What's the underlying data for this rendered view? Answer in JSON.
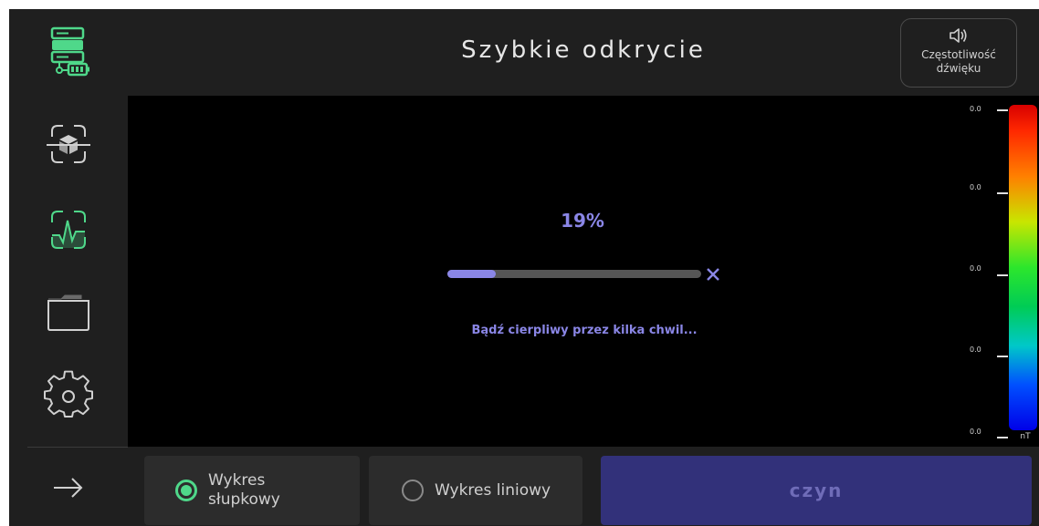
{
  "header": {
    "title": "Szybkie odkrycie",
    "sound_button": {
      "label": "Częstotliwość dźwięku",
      "icon": "speaker-icon"
    }
  },
  "sidebar": {
    "items": [
      {
        "name": "device-battery",
        "icon": "server-battery-icon",
        "active": true
      },
      {
        "name": "scan-3d",
        "icon": "scan-cube-icon",
        "active": false
      },
      {
        "name": "scan-signal",
        "icon": "scan-waveform-icon",
        "active": true
      },
      {
        "name": "files",
        "icon": "folder-icon",
        "active": false
      },
      {
        "name": "settings",
        "icon": "gear-icon",
        "active": false
      },
      {
        "name": "next",
        "icon": "arrow-right-icon",
        "active": false
      }
    ]
  },
  "progress": {
    "percent_label": "19%",
    "fraction": 0.19,
    "message": "Bądź cierpliwy przez kilka chwil..."
  },
  "scale": {
    "labels": [
      "0.0",
      "0.0",
      "0.0",
      "0.0",
      "0.0"
    ],
    "unit": "nT"
  },
  "bottom": {
    "options": [
      {
        "label": "Wykres słupkowy",
        "selected": true
      },
      {
        "label": "Wykres liniowy",
        "selected": false
      }
    ],
    "action_label": "czyn"
  },
  "colors": {
    "accent_purple": "#8a86e6",
    "active_green": "#4fd88a",
    "action_bg": "#32317a",
    "background": "#1f1f1f",
    "viewer_bg": "#000000"
  }
}
